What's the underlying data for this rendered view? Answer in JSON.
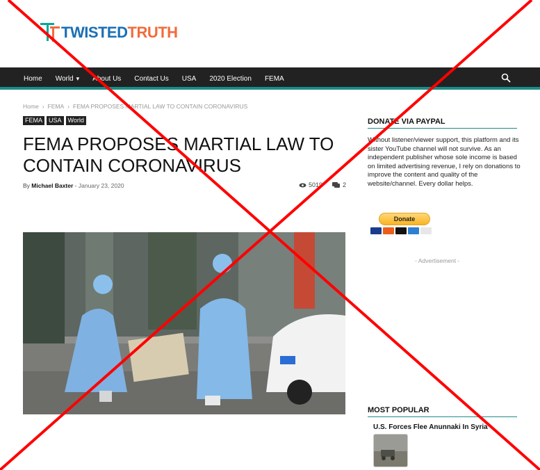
{
  "logo": {
    "part1": "TWISTED",
    "part2": "TRUTH"
  },
  "nav": {
    "items": [
      {
        "label": "Home"
      },
      {
        "label": "World"
      },
      {
        "label": "About Us"
      },
      {
        "label": "Contact Us"
      },
      {
        "label": "USA"
      },
      {
        "label": "2020 Election"
      },
      {
        "label": "FEMA"
      }
    ],
    "search_icon": "search-icon"
  },
  "breadcrumb": [
    "Home",
    "FEMA",
    "FEMA PROPOSES MARTIAL LAW TO CONTAIN CORONAVIRUS"
  ],
  "tags": [
    "FEMA",
    "USA",
    "World"
  ],
  "article": {
    "title": "FEMA PROPOSES MARTIAL LAW TO CONTAIN CORONAVIRUS",
    "by": "By",
    "author": "Michael Baxter",
    "date": "January 23, 2020",
    "views": "5019",
    "comments": "2"
  },
  "sidebar": {
    "donate_title": "DONATE VIA PAYPAL",
    "donate_text": "Without listener/viewer support, this platform and its sister YouTube channel will not survive. As an independent publisher whose sole income is based on limited advertising revenue, I rely on donations to improve the content and quality of the website/channel. Every dollar helps.",
    "donate_button": "Donate",
    "advertisement": "- Advertisement -",
    "popular_title": "MOST POPULAR",
    "popular_item": "U.S. Forces Flee Anunnaki In Syria"
  },
  "colors": {
    "accent": "#1c8c86",
    "logo_blue": "#1a6fb5",
    "logo_orange": "#f26b3a",
    "cross_red": "#ff0000"
  }
}
